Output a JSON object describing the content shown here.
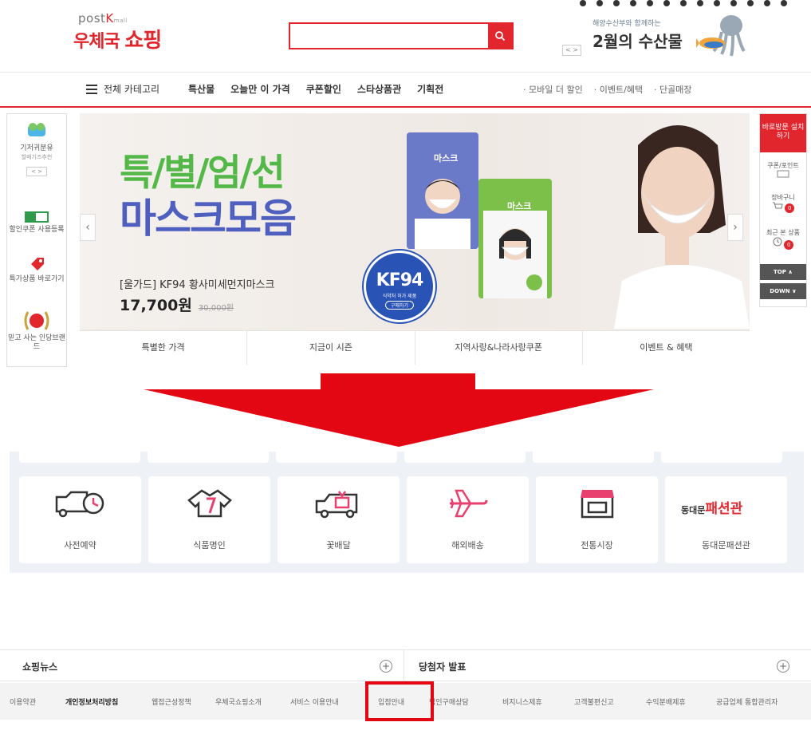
{
  "header": {
    "logo_post": "post",
    "logo_mall": "mall",
    "logo_name_a": "우체국",
    "logo_name_b": "쇼핑",
    "search_placeholder": "",
    "promo_subtitle": "해양수산부와 함께하는",
    "promo_title": "2월의 수산물",
    "promo_nav": "< >"
  },
  "nav": {
    "all_category": "전체 카테고리",
    "items": [
      "특산물",
      "오늘만 이 가격",
      "쿠폰할인",
      "스타상품관",
      "기획전"
    ],
    "sub_items": [
      "· 모바일 더 할인",
      "· 이벤트/혜택",
      "· 단골매장"
    ]
  },
  "left_sidebar": {
    "items": [
      {
        "label": "기저귀분유",
        "sub": "할배기즈추천"
      },
      {
        "label": "할인쿠폰 사용등록",
        "sub": ""
      },
      {
        "label": "특가상품 바로가기",
        "sub": ""
      },
      {
        "label": "믿고 사는 인당브랜드",
        "sub": ""
      }
    ]
  },
  "banner": {
    "title_line1": "특/별/엄/선",
    "title_line2": "마스크모음",
    "product": "[울가드] KF94 황사미세먼지마스크",
    "price": "17,700원",
    "old_price": "30,000원",
    "badge_main": "KF94",
    "badge_sub": "식약처 허가 제품",
    "badge_btn": "구매하기",
    "pack_label": "마스크",
    "tabs": [
      "특별한 가격",
      "지금이 시즌",
      "지역사랑&나라사랑쿠폰",
      "이벤트 & 혜택"
    ]
  },
  "right_sidebar": {
    "install": "바로방문 설치하기",
    "coupon": "쿠폰/포인트",
    "cart": "장바구니",
    "cart_count": "0",
    "recent": "최근 본 상품",
    "recent_count": "0",
    "top": "TOP ∧",
    "down": "DOWN ∨"
  },
  "services": {
    "top_row": [
      "",
      "",
      "",
      "",
      "",
      ""
    ],
    "cards": [
      {
        "label": "사전예약",
        "icon": "alarm-truck-icon"
      },
      {
        "label": "식품명인",
        "icon": "chef-jacket-icon"
      },
      {
        "label": "꽃배달",
        "icon": "gift-truck-icon"
      },
      {
        "label": "해외배송",
        "icon": "airplane-icon"
      },
      {
        "label": "전통시장",
        "icon": "market-stall-icon"
      },
      {
        "label": "동대문패션관",
        "icon": "dongdaemun-logo"
      }
    ],
    "dongdae_prefix": "동대문",
    "dongdae_main": "패션관"
  },
  "news": {
    "left_title": "쇼핑뉴스",
    "right_title": "당첨자 발표",
    "plus": "+"
  },
  "footer": {
    "links": [
      "이용약관",
      "개인정보처리방침",
      "웹접근성정책",
      "우체국쇼핑소개",
      "서비스 이용안내",
      "입점안내",
      "법인구매상담",
      "비지니스제휴",
      "고객불편신고",
      "수익분배제휴",
      "공급업체 통합관리자"
    ]
  },
  "colors": {
    "brand_red": "#e1262d",
    "mask_green": "#53b848",
    "mask_blue": "#4f5fbf",
    "service_pink": "#e8416f",
    "highlight": "#e30613"
  }
}
